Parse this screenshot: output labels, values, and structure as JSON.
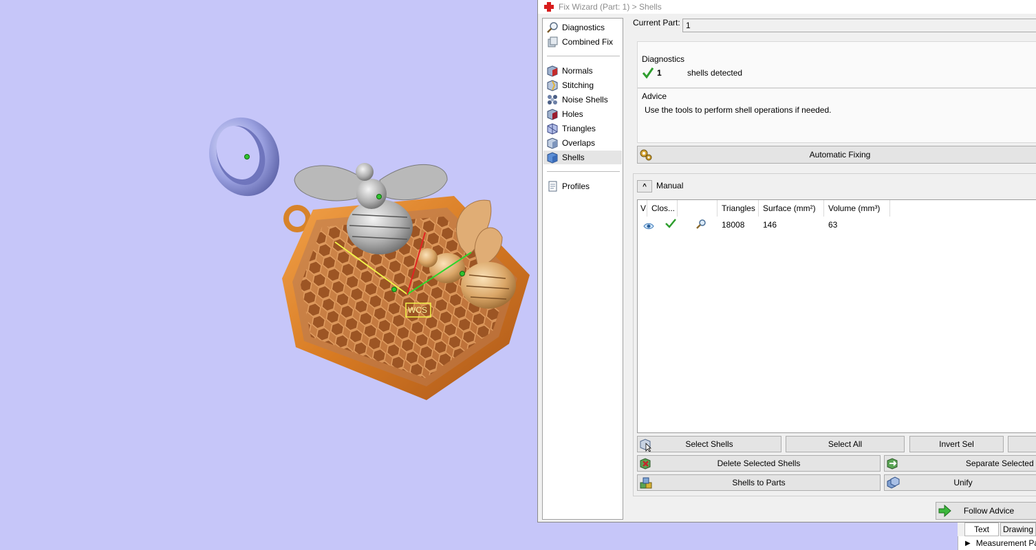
{
  "window": {
    "title": "Fix Wizard (Part: 1) > Shells"
  },
  "viewport": {
    "wcs_label": "WCS"
  },
  "nav": {
    "items": [
      {
        "label": "Diagnostics",
        "icon": "magnifier-icon"
      },
      {
        "label": "Combined Fix",
        "icon": "combined-fix-icon"
      },
      {
        "label": "Normals",
        "icon": "normals-icon"
      },
      {
        "label": "Stitching",
        "icon": "stitching-icon"
      },
      {
        "label": "Noise Shells",
        "icon": "noise-shells-icon"
      },
      {
        "label": "Holes",
        "icon": "holes-icon"
      },
      {
        "label": "Triangles",
        "icon": "triangles-icon"
      },
      {
        "label": "Overlaps",
        "icon": "overlaps-icon"
      },
      {
        "label": "Shells",
        "icon": "shells-icon",
        "active": true
      },
      {
        "label": "Profiles",
        "icon": "profiles-icon"
      }
    ]
  },
  "current_part": {
    "label": "Current Part:",
    "value": "1"
  },
  "diagnostics": {
    "title": "Diagnostics",
    "count": "1",
    "text": "shells detected"
  },
  "advice": {
    "title": "Advice",
    "text": "Use the tools to perform shell operations if needed."
  },
  "auto_fix_label": "Automatic Fixing",
  "manual": {
    "toggle": "^",
    "label": "Manual"
  },
  "table": {
    "headers": [
      "V",
      "Clos...",
      "",
      "Triangles",
      "Surface (mm²)",
      "Volume (mm³)"
    ],
    "rows": [
      {
        "triangles": "18008",
        "surface": "146",
        "volume": "63"
      }
    ]
  },
  "buttons": {
    "select_shells": "Select Shells",
    "select_all": "Select All",
    "invert_sel": "Invert Sel",
    "delete_selected": "Delete Selected Shells",
    "separate_selected": "Separate Selected S",
    "shells_to_parts": "Shells to Parts",
    "unify": "Unify",
    "follow_advice": "Follow Advice"
  },
  "bottom_tabs": {
    "text": "Text",
    "drawing": "Drawing",
    "measurement": "Measurement Pag"
  },
  "colors": {
    "viewport_bg": "#c6c6f9",
    "accent_green": "#2e9e2e",
    "gold": "#d7832a"
  }
}
